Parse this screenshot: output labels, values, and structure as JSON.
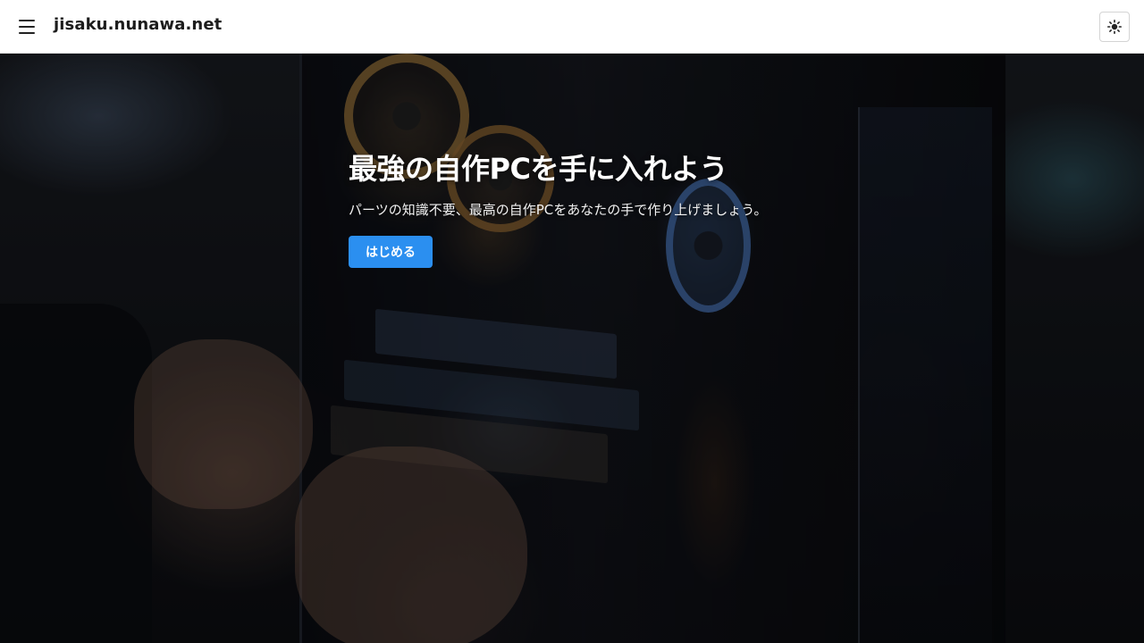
{
  "header": {
    "site_title": "jisaku.nunawa.net",
    "menu_icon": "hamburger-menu-icon",
    "theme_toggle_icon": "sun-icon"
  },
  "hero": {
    "title": "最強の自作PCを手に入れよう",
    "subtitle": "パーツの知識不要、最高の自作PCをあなたの手で作り上げましょう。",
    "cta_label": "はじめる",
    "background_image": "photo of hands assembling parts into an open PC case with glowing fans",
    "colors": {
      "cta": "#2b8ff0",
      "title": "#ffffff"
    }
  }
}
